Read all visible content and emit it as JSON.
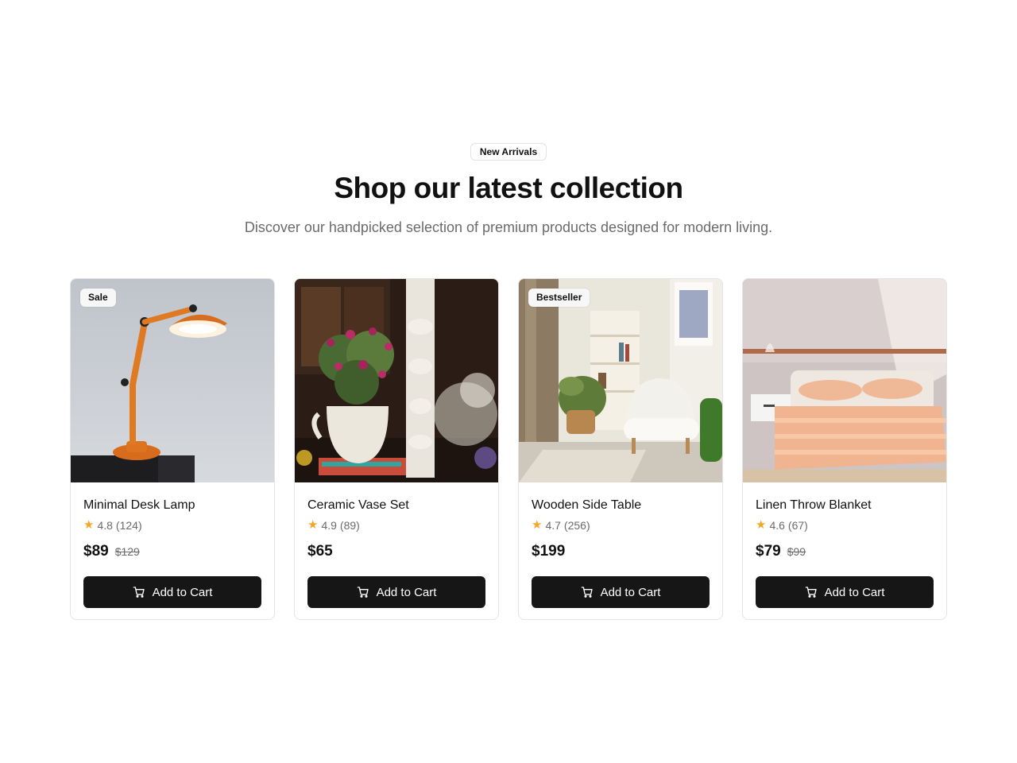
{
  "section": {
    "badge": "New Arrivals",
    "title": "Shop our latest collection",
    "subtitle": "Discover our handpicked selection of premium products designed for modern living."
  },
  "products": [
    {
      "name": "Minimal Desk Lamp",
      "rating": "4.8",
      "reviews": "(124)",
      "price": "$89",
      "old_price": "$129",
      "tag": "Sale",
      "button": "Add to Cart",
      "image": "desk-lamp-photo"
    },
    {
      "name": "Ceramic Vase Set",
      "rating": "4.9",
      "reviews": "(89)",
      "price": "$65",
      "old_price": "",
      "tag": "",
      "button": "Add to Cart",
      "image": "vase-flowers-photo"
    },
    {
      "name": "Wooden Side Table",
      "rating": "4.7",
      "reviews": "(256)",
      "price": "$199",
      "old_price": "",
      "tag": "Bestseller",
      "button": "Add to Cart",
      "image": "living-room-photo"
    },
    {
      "name": "Linen Throw Blanket",
      "rating": "4.6",
      "reviews": "(67)",
      "price": "$79",
      "old_price": "$99",
      "tag": "",
      "button": "Add to Cart",
      "image": "bedroom-photo"
    }
  ],
  "colors": {
    "accent": "#161616",
    "star": "#f5a623",
    "muted": "#6b6b6b",
    "border": "#e4e4e7"
  },
  "icons": {
    "star": "star-icon",
    "cart": "cart-icon"
  }
}
